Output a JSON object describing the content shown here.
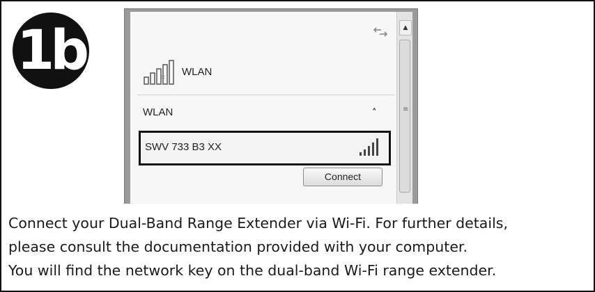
{
  "step": {
    "label": "1b"
  },
  "network_panel": {
    "top_entry_label": "WLAN",
    "group_header": "WLAN",
    "selected_network": "SWV 733 B3 XX",
    "connect_button_label": "Connect"
  },
  "instructions": {
    "line1": "Connect your Dual-Band Range Extender via Wi-Fi. For further details,",
    "line2": "please consult the documentation provided with your computer.",
    "line3": "You will find the network key on the dual-band Wi-Fi range extender."
  },
  "icons": {
    "refresh": "refresh-icon",
    "wifi_bars": "signal-bars-icon",
    "collapse": "chevron-up-icon",
    "scroll_up": "scroll-up-arrow-icon"
  }
}
